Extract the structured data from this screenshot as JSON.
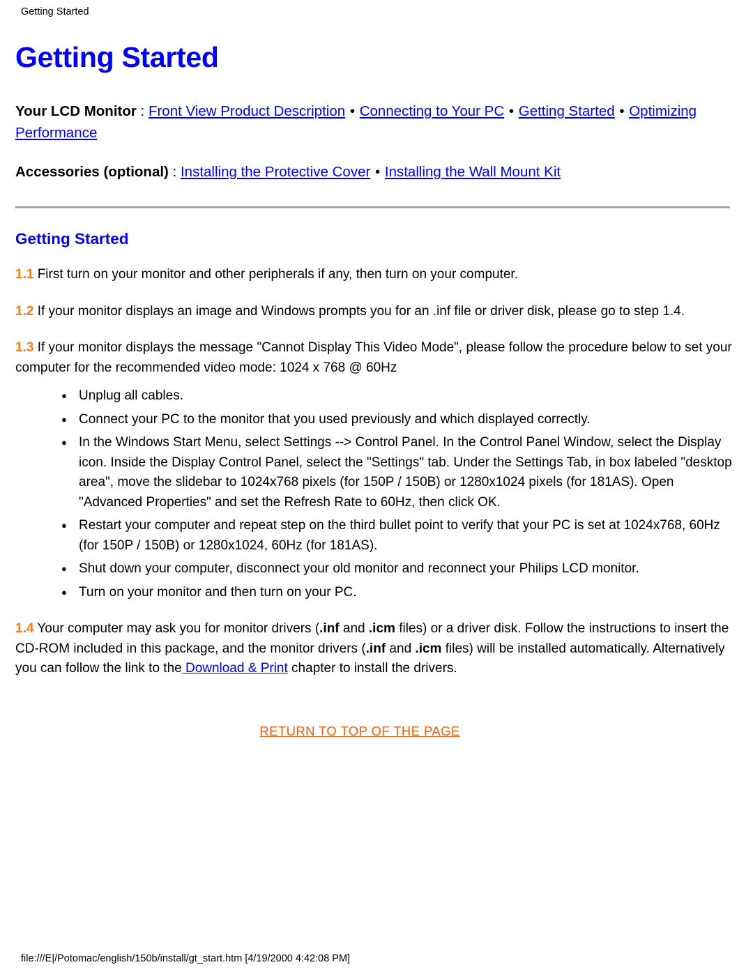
{
  "document": {
    "running_header": "Getting Started",
    "title": "Getting Started"
  },
  "nav": {
    "line1": {
      "label": "Your LCD Monitor",
      "colon": " : ",
      "links": [
        "Front View Product Description",
        "Connecting to Your PC",
        "Getting Started",
        "Optimizing Performance"
      ],
      "separator": "•"
    },
    "line2": {
      "label": "Accessories (optional)",
      "colon": " : ",
      "links": [
        "Installing the Protective Cover",
        "Installing the Wall Mount Kit"
      ],
      "separator": "•"
    }
  },
  "section": {
    "heading": "Getting Started",
    "steps": [
      {
        "num": "1.1",
        "text": " First turn on your monitor and other peripherals if any, then turn on your computer."
      },
      {
        "num": "1.2",
        "text": " If your monitor displays an image and Windows prompts you for an .inf file or driver disk, please go to step 1.4."
      },
      {
        "num": "1.3",
        "text": " If your monitor displays the message \"Cannot Display This Video Mode\", please follow the procedure below to set your computer for the recommended video mode: 1024 x 768 @ 60Hz"
      }
    ],
    "bullets": [
      "Unplug all cables.",
      "Connect your PC to the monitor that you used previously and which displayed correctly.",
      "In the Windows Start Menu, select Settings --> Control Panel. In the Control Panel Window, select the Display icon. Inside the Display Control Panel, select the \"Settings\" tab. Under the Settings Tab, in box labeled \"desktop area\", move the slidebar to 1024x768 pixels (for 150P / 150B) or 1280x1024 pixels (for 181AS). Open \"Advanced Properties\" and set the Refresh Rate to 60Hz, then click OK.",
      "Restart your computer and repeat step on the third bullet point to verify that your PC is set at 1024x768, 60Hz (for 150P / 150B) or 1280x1024, 60Hz (for 181AS).",
      "Shut down your computer, disconnect your old monitor and reconnect your Philips LCD monitor.",
      "Turn on your monitor and then turn on your PC."
    ],
    "step14": {
      "num": "1.4",
      "part1": " Your computer may ask you for monitor drivers (",
      "inf1": ".inf",
      "part2": " and ",
      "icm1": ".icm",
      "part3": " files) or a driver disk. Follow the instructions to insert the CD-ROM included in this package, and the monitor drivers (",
      "inf2": ".inf",
      "part4": " and ",
      "icm2": ".icm",
      "part5": " files) will be installed automatically. Alternatively you can follow the link to the",
      "link": " Download & Print",
      "part6": " chapter to install the drivers."
    }
  },
  "footer": {
    "return_link": "RETURN TO TOP OF THE PAGE",
    "path": "file:///E|/Potomac/english/150b/install/gt_start.htm [4/19/2000 4:42:08 PM]"
  },
  "colors": {
    "link_blue": "#0000EE",
    "accent_orange": "#F47B20",
    "return_orange": "#F06010"
  }
}
